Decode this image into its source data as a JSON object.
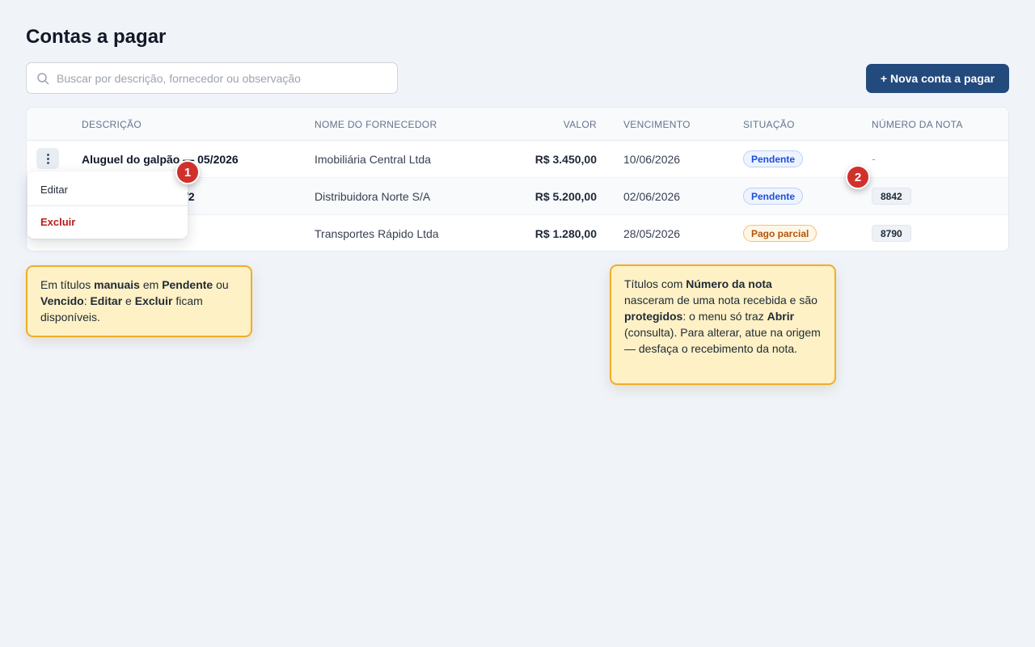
{
  "page": {
    "title": "Contas a pagar"
  },
  "search": {
    "placeholder": "Buscar por descrição, fornecedor ou observação"
  },
  "actions": {
    "new_label": "+ Nova conta a pagar"
  },
  "table": {
    "headers": {
      "descricao": "DESCRIÇÃO",
      "fornecedor": "NOME DO FORNECEDOR",
      "valor": "VALOR",
      "vencimento": "VENCIMENTO",
      "situacao": "SITUAÇÃO",
      "nota": "NÚMERO DA NOTA"
    },
    "rows": [
      {
        "descricao": "Aluguel do galpão — 05/2026",
        "fornecedor": "Imobiliária Central Ltda",
        "valor": "R$ 3.450,00",
        "vencimento": "10/06/2026",
        "situacao": "Pendente",
        "nota": "-"
      },
      {
        "descricao": "/2",
        "fornecedor": "Distribuidora Norte S/A",
        "valor": "R$ 5.200,00",
        "vencimento": "02/06/2026",
        "situacao": "Pendente",
        "nota": "8842"
      },
      {
        "descricao": "",
        "fornecedor": "Transportes Rápido Ltda",
        "valor": "R$ 1.280,00",
        "vencimento": "28/05/2026",
        "situacao": "Pago parcial",
        "nota": "8790"
      }
    ]
  },
  "row_menu": {
    "edit_label": "Editar",
    "delete_label": "Excluir"
  },
  "markers": {
    "one": "1",
    "two": "2"
  },
  "callouts": {
    "manual": {
      "t1": "Em títulos ",
      "b1": "manuais",
      "t2": " em ",
      "b2": "Pendente",
      "t3": " ou ",
      "b3": "Vencido",
      "t4": ": ",
      "b4": "Editar",
      "t5": " e ",
      "b5": "Excluir",
      "t6": " ficam disponíveis."
    },
    "protected": {
      "t1": "Títulos com ",
      "b1": "Número da nota",
      "t2": " nasceram de uma nota recebida e são ",
      "b2": "protegidos",
      "t3": ": o menu só traz ",
      "b3": "Abrir",
      "t4": " (consulta). Para alterar, atue na origem — desfaça o recebimento da nota."
    }
  },
  "colors": {
    "primary": "#234a7d",
    "badge_pendente": "#1d4ed8",
    "badge_parcial": "#b45309",
    "danger": "#b91c1c",
    "marker": "#d0312d",
    "callout_bg": "#fdf1c5",
    "callout_border": "#f0ac2a"
  }
}
